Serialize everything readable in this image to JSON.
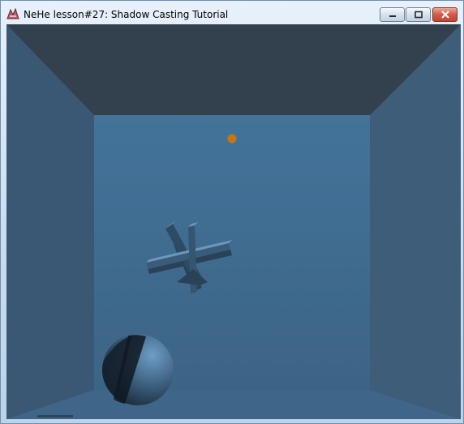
{
  "window": {
    "title": "NeHe lesson#27: Shadow Casting Tutorial",
    "app_icon": "nehe-app-icon",
    "controls": {
      "minimize": "minimize-icon",
      "maximize": "maximize-icon",
      "close": "close-icon"
    }
  },
  "scene": {
    "description_colors": {
      "ceiling": "#33414f",
      "left_wall": "#3a5873",
      "right_wall": "#3d5d78",
      "back_wall": "#416f94",
      "floor": "#3d6384",
      "light": "#c8760f"
    }
  }
}
